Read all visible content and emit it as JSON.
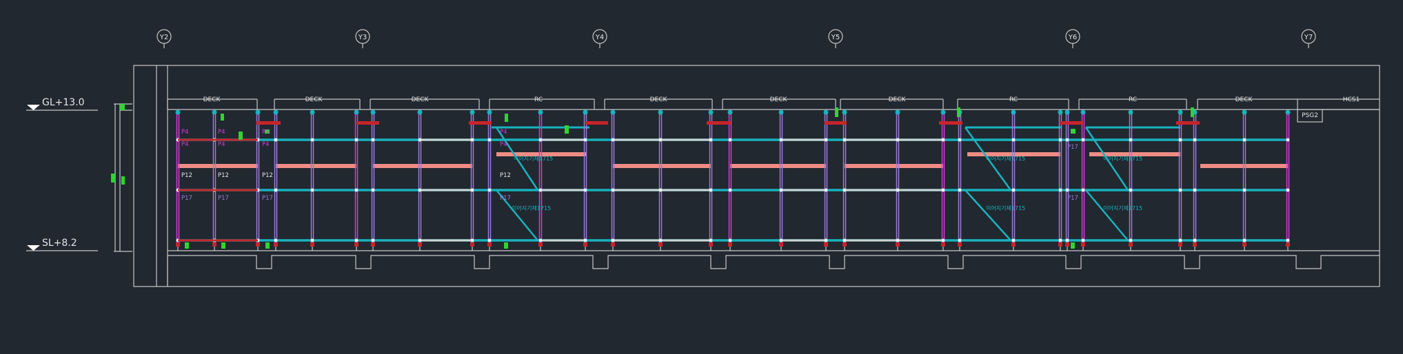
{
  "drawing": {
    "grid_axes": [
      "Y2",
      "Y3",
      "Y4",
      "Y5",
      "Y6",
      "Y7"
    ],
    "levels": {
      "top": "GL+13.0",
      "bottom": "SL+8.2"
    },
    "bay_labels": [
      "DECK",
      "DECK",
      "DECK",
      "RC",
      "DECK",
      "DECK",
      "DECK",
      "RC",
      "RC",
      "DECK"
    ],
    "end_labels": {
      "psg": "PSG2",
      "hcs": "HCS1"
    },
    "post_labels": {
      "p4": "P4",
      "p12": "P12",
      "p17": "P17"
    },
    "brace_label": "이어지기제1715"
  },
  "colors": {
    "background": "#212830",
    "outline": "#c8c8c8",
    "ledger_cyan": "#19b3bd",
    "ledger_white": "#d2d2d2",
    "beam_salmon": "#f08c84",
    "post_violet": "#9c7ad8",
    "post_magenta": "#d23cd8",
    "base_red": "#c8242a",
    "marker_green": "#2fd52f"
  }
}
